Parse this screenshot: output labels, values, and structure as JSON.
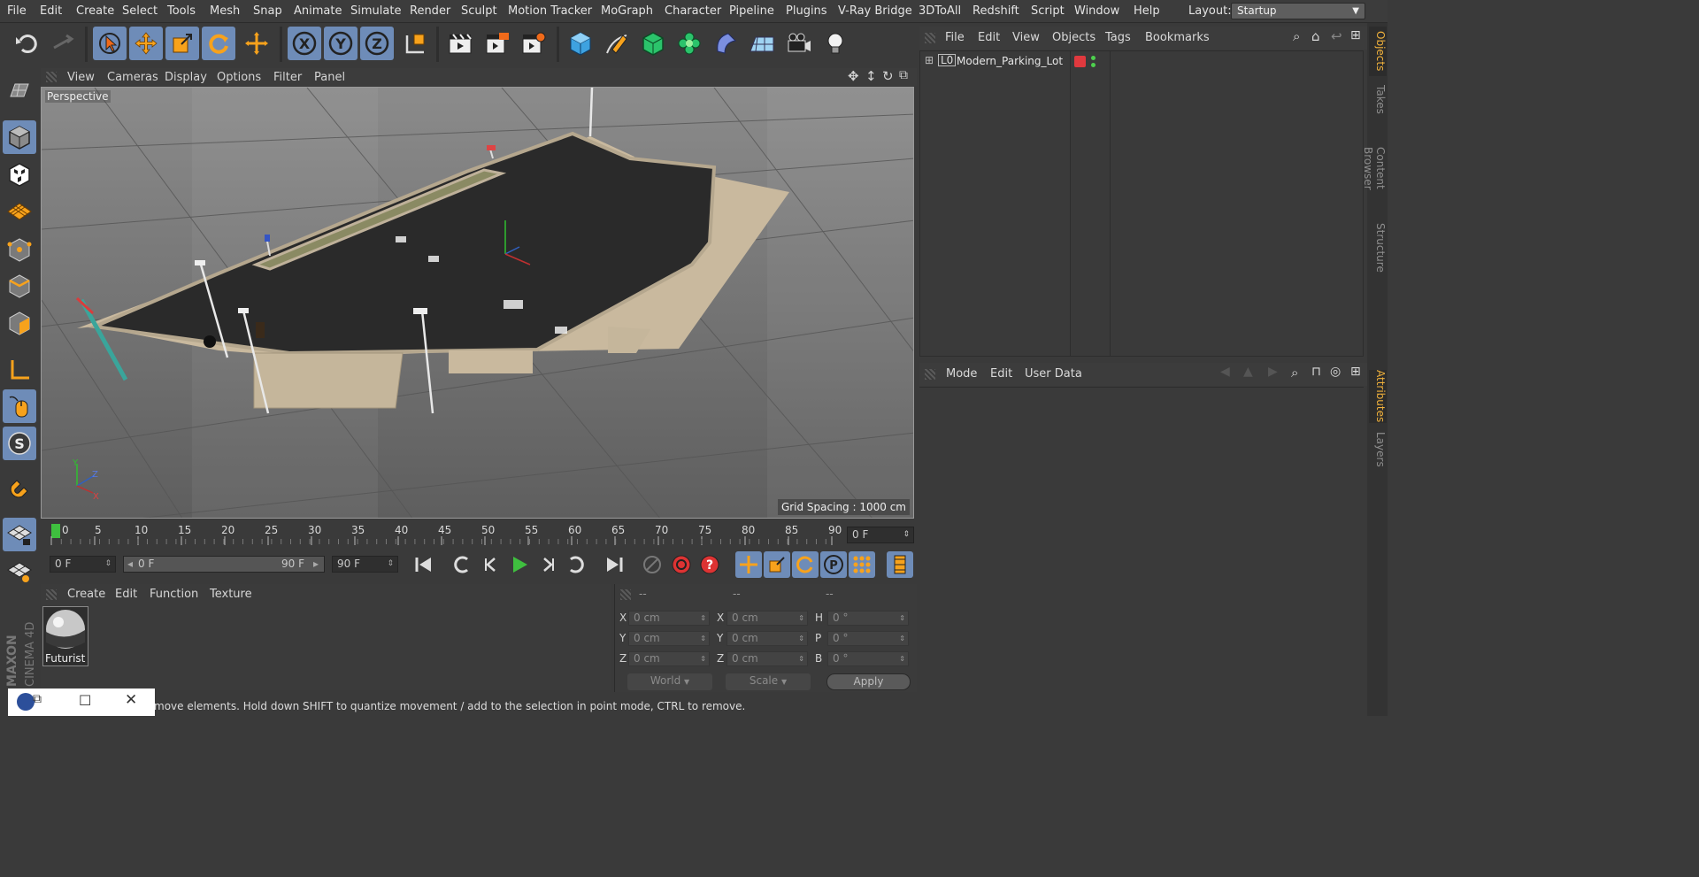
{
  "menubar": {
    "items": [
      "File",
      "Edit",
      "Create",
      "Select",
      "Tools",
      "Mesh",
      "Snap",
      "Animate",
      "Simulate",
      "Render",
      "Sculpt",
      "Motion Tracker",
      "MoGraph",
      "Character",
      "Pipeline",
      "Plugins",
      "V-Ray Bridge",
      "3DToAll",
      "Redshift",
      "Script",
      "Window",
      "Help"
    ],
    "layout_label": "Layout:",
    "layout_value": "Startup"
  },
  "toolbar": {
    "icons": [
      "undo-icon",
      "redo-icon",
      "live-selection-icon",
      "move-icon",
      "scale-icon",
      "rotate-icon",
      "last-tool-icon",
      "x-axis-icon",
      "y-axis-icon",
      "z-axis-icon",
      "coordinate-system-icon",
      "render-view-icon",
      "render-picture-viewer-icon",
      "render-settings-icon",
      "cube-primitive-icon",
      "pen-spline-icon",
      "subdivision-icon",
      "cloner-icon",
      "deformer-icon",
      "floor-icon",
      "camera-icon",
      "light-icon"
    ],
    "x_label": "X",
    "y_label": "Y",
    "z_label": "Z"
  },
  "viewport": {
    "menu": [
      "View",
      "Cameras",
      "Display",
      "Options",
      "Filter",
      "Panel"
    ],
    "label": "Perspective",
    "grid_spacing": "Grid Spacing : 1000 cm",
    "axis_x": "X",
    "axis_y": "Y",
    "axis_z": "Z"
  },
  "timeline": {
    "ticks": [
      "0",
      "5",
      "10",
      "15",
      "20",
      "25",
      "30",
      "35",
      "40",
      "45",
      "50",
      "55",
      "60",
      "65",
      "70",
      "75",
      "80",
      "85",
      "90"
    ],
    "current_frame": "0 F",
    "start_field": "0 F",
    "range_start": "0 F",
    "range_end": "90 F",
    "end_field": "90 F"
  },
  "materials": {
    "menu": [
      "Create",
      "Edit",
      "Function",
      "Texture"
    ],
    "items": [
      {
        "name": "Futurist"
      }
    ]
  },
  "coordinates": {
    "headers": [
      "--",
      "--",
      "--"
    ],
    "pos_labels": [
      "X",
      "Y",
      "Z"
    ],
    "size_labels": [
      "X",
      "Y",
      "Z"
    ],
    "rot_labels": [
      "H",
      "P",
      "B"
    ],
    "pos_values": [
      "0 cm",
      "0 cm",
      "0 cm"
    ],
    "size_values": [
      "0 cm",
      "0 cm",
      "0 cm"
    ],
    "rot_values": [
      "0 °",
      "0 °",
      "0 °"
    ],
    "mode_world": "World",
    "mode_scale": "Scale",
    "apply": "Apply"
  },
  "object_manager": {
    "menu": [
      "File",
      "Edit",
      "View",
      "Objects",
      "Tags",
      "Bookmarks"
    ],
    "objects": [
      {
        "name": "Modern_Parking_Lot",
        "layer_color": "#e0393e"
      }
    ]
  },
  "attributes": {
    "menu": [
      "Mode",
      "Edit",
      "User Data"
    ]
  },
  "side_tabs": {
    "right_top": [
      "Objects",
      "Takes",
      "Content Browser",
      "Structure"
    ],
    "right_bottom": [
      "Attributes",
      "Layers"
    ]
  },
  "status": {
    "text": "move elements. Hold down SHIFT to quantize movement / add to the selection in point mode, CTRL to remove."
  },
  "brand": {
    "maxon": "MAXON",
    "cinema": "CINEMA 4D"
  },
  "colors": {
    "accent": "#6e8cb8",
    "highlight": "#f0b13c",
    "play": "#3fbf3f"
  }
}
